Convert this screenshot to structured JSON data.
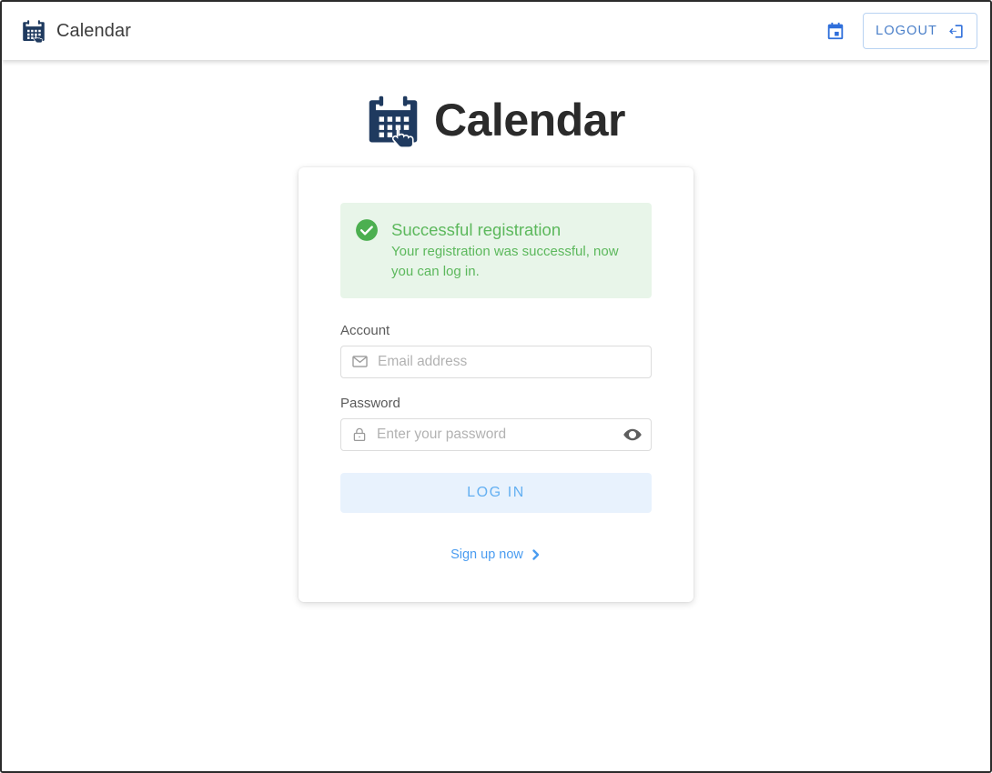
{
  "app_bar": {
    "brand_icon": "calendar-hand-icon",
    "brand_label": "Calendar",
    "calendar_icon": "calendar-event-icon",
    "logout_label": "LOGOUT",
    "logout_icon": "logout-arrow-icon"
  },
  "page": {
    "title_icon": "calendar-hand-icon",
    "title": "Calendar"
  },
  "alert": {
    "icon": "check-circle-icon",
    "title": "Successful registration",
    "message": "Your registration was successful, now you can log in."
  },
  "form": {
    "account": {
      "label": "Account",
      "icon": "envelope-icon",
      "placeholder": "Email address",
      "value": ""
    },
    "password": {
      "label": "Password",
      "icon": "lock-icon",
      "placeholder": "Enter your password",
      "value": "",
      "toggle_icon": "eye-icon"
    },
    "submit_label": "LOG IN",
    "signup_label": "Sign up now",
    "signup_icon": "chevron-right-icon"
  },
  "colors": {
    "brand_navy": "#1f3a5f",
    "accent_blue": "#2f6fdb",
    "link_blue": "#4a9cf0",
    "button_blue_text": "#64b0f2",
    "button_blue_bg": "#e8f2fd",
    "success_green": "#5cb85c",
    "success_bg": "#e8f5e9",
    "icon_gray": "#9a9a9a"
  }
}
